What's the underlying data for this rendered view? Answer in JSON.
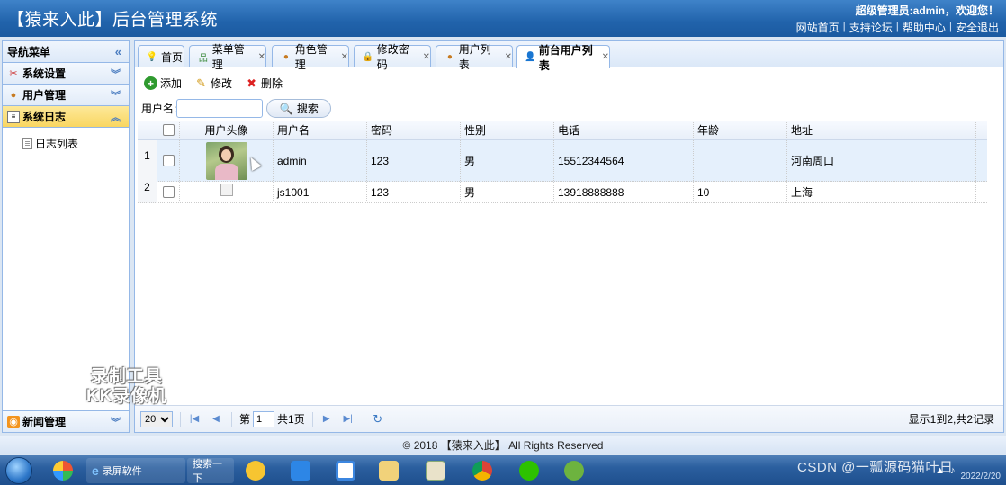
{
  "app": {
    "title": "【猿来入此】后台管理系统",
    "welcome": "超级管理员:admin，欢迎您！",
    "links": [
      "网站首页",
      "支持论坛",
      "帮助中心",
      "安全退出"
    ]
  },
  "nav": {
    "header": "导航菜单",
    "sections": {
      "system": "系统设置",
      "users": "用户管理",
      "logs": "系统日志",
      "news": "新闻管理"
    },
    "log_items": [
      "日志列表"
    ]
  },
  "tabs": [
    {
      "label": "首页"
    },
    {
      "label": "菜单管理"
    },
    {
      "label": "角色管理"
    },
    {
      "label": "修改密码"
    },
    {
      "label": "用户列表"
    },
    {
      "label": "前台用户列表"
    }
  ],
  "toolbar": {
    "add": "添加",
    "edit": "修改",
    "delete": "删除"
  },
  "search": {
    "label": "用户名:",
    "value": "",
    "button": "搜索"
  },
  "table": {
    "columns": [
      "用户头像",
      "用户名",
      "密码",
      "性别",
      "电话",
      "年龄",
      "地址"
    ],
    "row_numbers": [
      "1",
      "2"
    ],
    "rows": [
      {
        "username": "admin",
        "password": "123",
        "sex": "男",
        "phone": "15512344564",
        "age": "",
        "address": "河南周口"
      },
      {
        "username": "js1001",
        "password": "123",
        "sex": "男",
        "phone": "13918888888",
        "age": "10",
        "address": "上海"
      }
    ]
  },
  "pager": {
    "page_size": "20",
    "page_prefix": "第",
    "page": "1",
    "page_total": "共1页",
    "info": "显示1到2,共2记录"
  },
  "footer": "© 2018 【猿来入此】 All Rights Reserved",
  "taskbar": {
    "ie_task": "录屏软件",
    "search_task": "搜索一下",
    "date": "2022/2/20"
  },
  "watermarks": {
    "kk_line1": "录制工具",
    "kk_line2": "KK录像机",
    "csdn": "CSDN @一瓢源码猫叶日"
  },
  "colors": {
    "header": "#2163ab",
    "panel_border": "#95b8e7",
    "active_section": "#f9d661",
    "selected_row": "#e5f0fc"
  }
}
